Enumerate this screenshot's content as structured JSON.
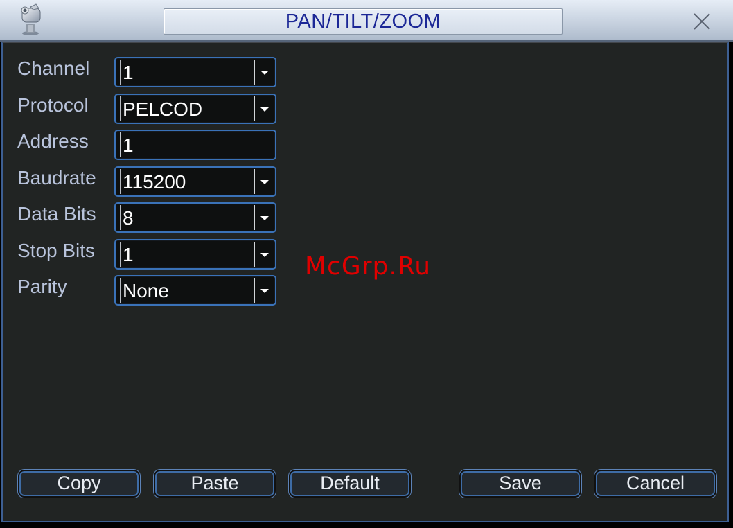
{
  "window": {
    "title": "PAN/TILT/ZOOM"
  },
  "icons": {
    "app": "ptz-camera-icon",
    "close": "close-icon",
    "dropdown": "chevron-down-icon"
  },
  "form": {
    "channel": {
      "label": "Channel",
      "value": "1"
    },
    "protocol": {
      "label": "Protocol",
      "value": "PELCOD"
    },
    "address": {
      "label": "Address",
      "value": "1"
    },
    "baudrate": {
      "label": "Baudrate",
      "value": "115200"
    },
    "data_bits": {
      "label": "Data Bits",
      "value": "8"
    },
    "stop_bits": {
      "label": "Stop Bits",
      "value": "1"
    },
    "parity": {
      "label": "Parity",
      "value": "None"
    }
  },
  "buttons": {
    "copy": "Copy",
    "paste": "Paste",
    "default": "Default",
    "save": "Save",
    "cancel": "Cancel"
  },
  "watermark": "McGrp.Ru",
  "colors": {
    "title_text": "#1b2796",
    "label_text": "#b9c4dc",
    "field_border": "#3a72b8",
    "panel_background": "#212423",
    "watermark": "#e00000"
  }
}
